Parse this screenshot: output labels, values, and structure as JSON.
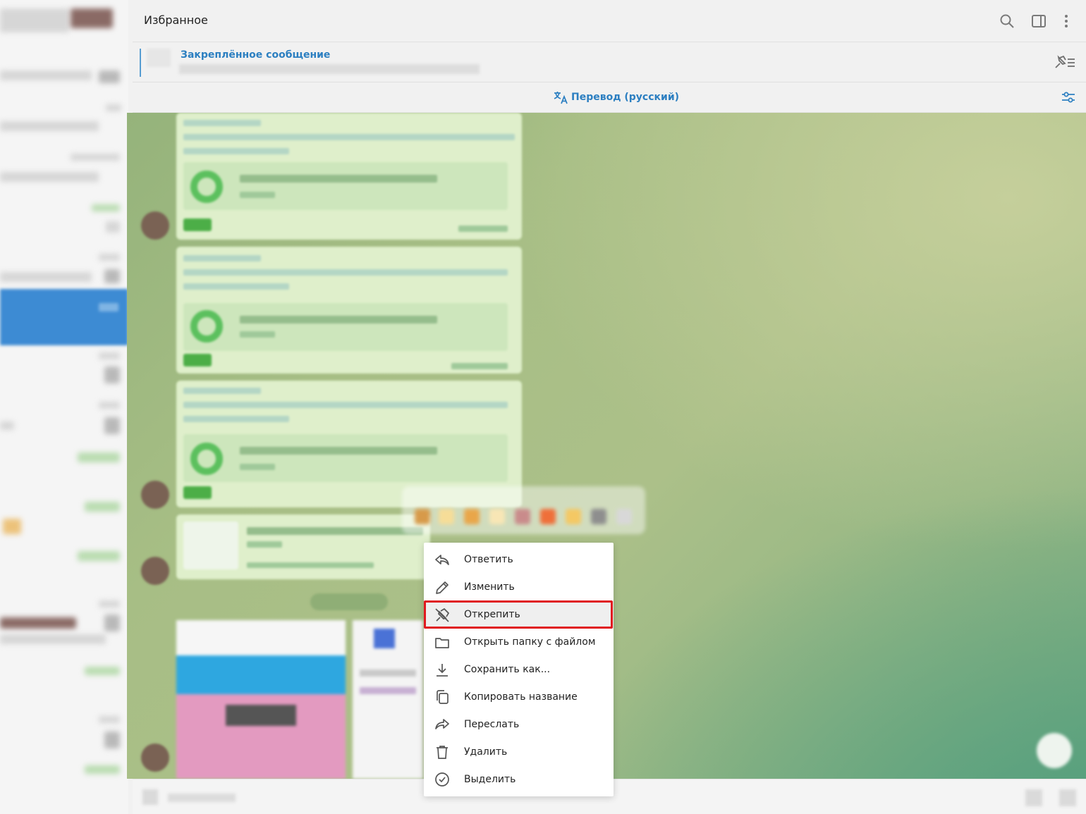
{
  "window": {
    "title": "Избранное"
  },
  "header": {
    "title": "Избранное",
    "icons": [
      "search-icon",
      "sidebar-toggle-icon",
      "more-vertical-icon"
    ]
  },
  "pinned": {
    "title": "Закреплённое сообщение",
    "icon": "pin-list-icon"
  },
  "translate": {
    "label": "Перевод (русский)",
    "icon": "translate-icon",
    "settings_icon": "settings-sliders-icon"
  },
  "context_menu": {
    "items": [
      {
        "label": "Ответить",
        "icon": "reply-icon"
      },
      {
        "label": "Изменить",
        "icon": "edit-pencil-icon"
      },
      {
        "label": "Открепить",
        "icon": "unpin-icon",
        "highlighted": true
      },
      {
        "label": "Открыть папку с файлом",
        "icon": "folder-icon"
      },
      {
        "label": "Сохранить как...",
        "icon": "download-icon"
      },
      {
        "label": "Копировать название",
        "icon": "copy-icon"
      },
      {
        "label": "Переслать",
        "icon": "forward-icon"
      },
      {
        "label": "Удалить",
        "icon": "trash-icon"
      },
      {
        "label": "Выделить",
        "icon": "select-check-icon"
      }
    ]
  },
  "colors": {
    "accent": "#2c7fc1",
    "selected_chat": "#3d8bd3",
    "highlight_box": "#e0191f",
    "bubble": "#dfefcb"
  }
}
